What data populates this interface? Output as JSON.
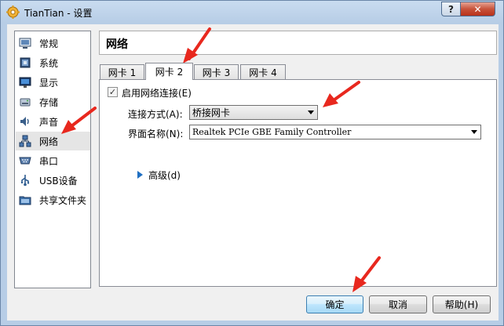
{
  "window": {
    "title": "TianTian - 设置",
    "help_btn": "?",
    "close_btn": "✕"
  },
  "sidebar": {
    "items": [
      {
        "label": "常规",
        "icon": "general-icon"
      },
      {
        "label": "系统",
        "icon": "system-icon"
      },
      {
        "label": "显示",
        "icon": "display-icon"
      },
      {
        "label": "存储",
        "icon": "storage-icon"
      },
      {
        "label": "声音",
        "icon": "audio-icon"
      },
      {
        "label": "网络",
        "icon": "network-icon",
        "selected": true
      },
      {
        "label": "串口",
        "icon": "serial-port-icon"
      },
      {
        "label": "USB设备",
        "icon": "usb-icon"
      },
      {
        "label": "共享文件夹",
        "icon": "shared-folder-icon"
      }
    ]
  },
  "main": {
    "title": "网络",
    "tabs": [
      {
        "label": "网卡 1"
      },
      {
        "label": "网卡 2",
        "active": true
      },
      {
        "label": "网卡 3"
      },
      {
        "label": "网卡 4"
      }
    ],
    "enable_label": "启用网络连接(E)",
    "enable_checked": true,
    "check_mark": "✓",
    "attached_label": "连接方式(A):",
    "attached_value": "桥接网卡",
    "name_label": "界面名称(N):",
    "name_value": "Realtek PCIe GBE Family Controller",
    "advanced_label": "高级(d)"
  },
  "buttons": {
    "ok": "确定",
    "cancel": "取消",
    "help": "帮助(H)"
  },
  "colors": {
    "annotation": "#e8281e",
    "title_bar": "#c9dcf0",
    "close_button": "#c8533b"
  }
}
